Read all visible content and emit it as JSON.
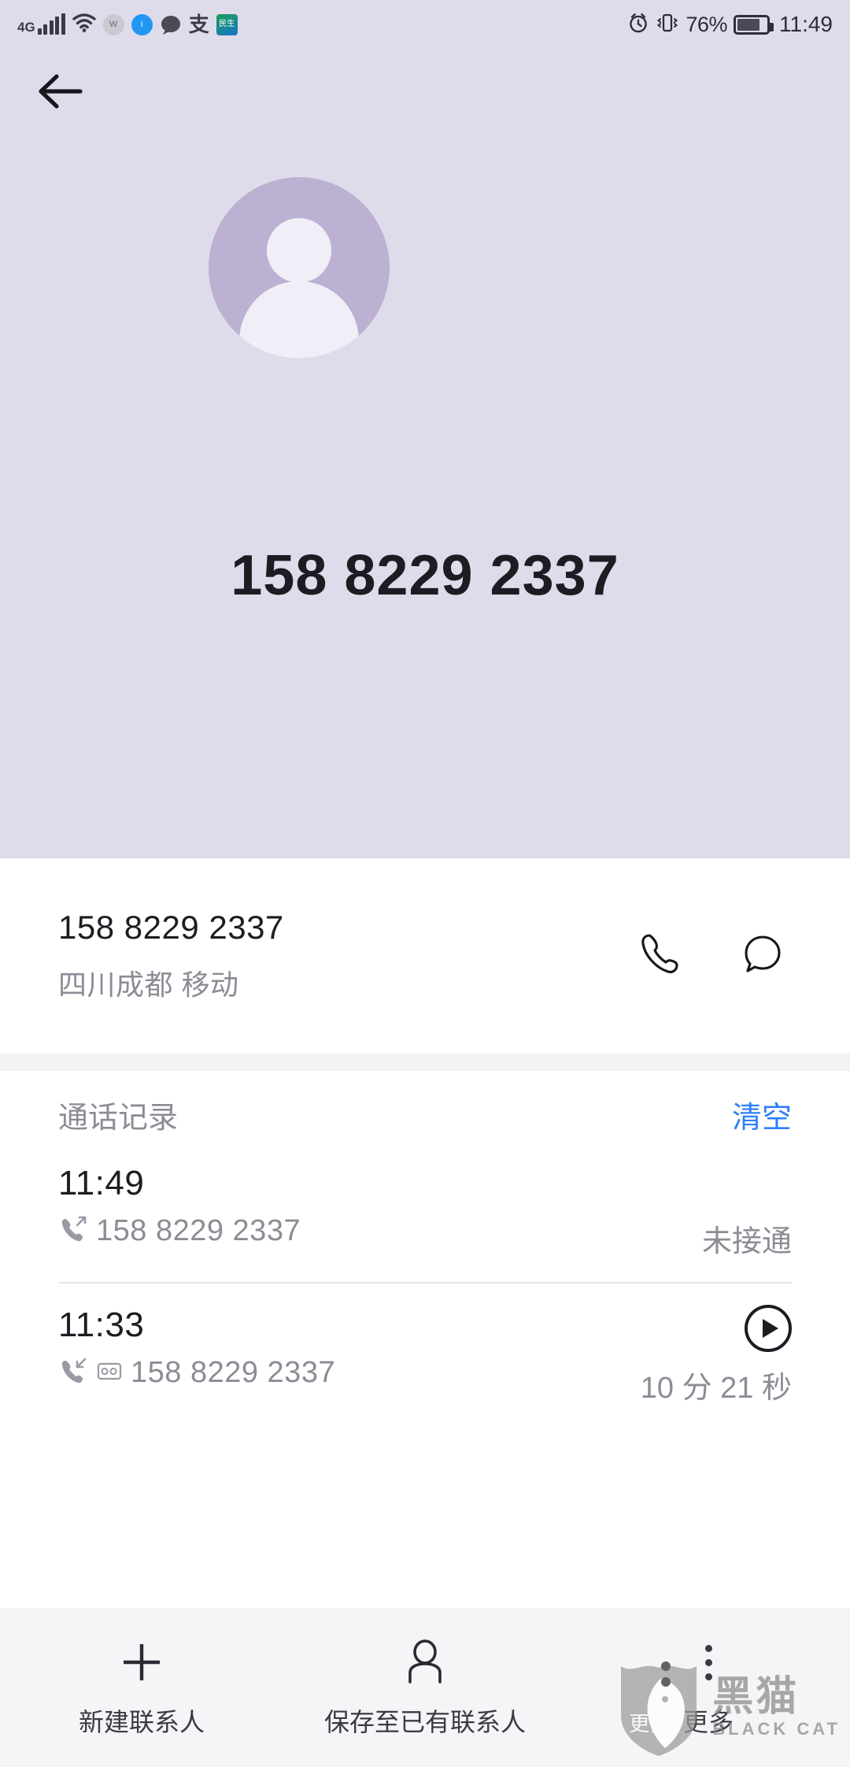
{
  "statusbar": {
    "network": "4G",
    "signal_icon": "signal-bars-icon",
    "wifi_icon": "wifi-icon",
    "app_icons": [
      "app-icon-grey",
      "app-icon-blue",
      "app-icon-bubble",
      "app-icon-alipay",
      "app-icon-minsheng"
    ],
    "alipay_glyph": "支",
    "minsheng_glyph": "民生",
    "alarm_icon": "alarm-clock-icon",
    "vibrate_icon": "vibrate-icon",
    "battery_percent": "76%",
    "battery_icon": "battery-icon",
    "time": "11:49"
  },
  "header": {
    "back_icon": "back-arrow-icon",
    "avatar_icon": "default-avatar-icon",
    "phone_number": "158 8229 2337",
    "background_color": "#dedcea",
    "avatar_color": "#bdb1d3"
  },
  "info_card": {
    "number": "158 8229 2337",
    "carrier": "四川成都 移动",
    "call_icon": "phone-call-icon",
    "message_icon": "message-bubble-icon"
  },
  "call_log": {
    "title": "通话记录",
    "clear_label": "清空",
    "clear_color": "#2d7ff9",
    "records": [
      {
        "time": "11:49",
        "direction_icon": "outgoing-call-icon",
        "has_recording": false,
        "number": "158 8229 2337",
        "status": "未接通",
        "duration": "",
        "playable": false
      },
      {
        "time": "11:33",
        "direction_icon": "incoming-call-icon",
        "has_recording": true,
        "recording_icon": "voice-recording-icon",
        "number": "158 8229 2337",
        "status": "",
        "duration": "10 分 21 秒",
        "playable": true,
        "play_icon": "play-circle-icon"
      }
    ]
  },
  "bottom_bar": {
    "items": [
      {
        "icon": "plus-icon",
        "label": "新建联系人"
      },
      {
        "icon": "person-icon",
        "label": "保存至已有联系人"
      },
      {
        "icon": "more-dots-icon",
        "label": "更多"
      }
    ]
  },
  "watermark": {
    "cn": "黑猫",
    "en": "BLACK CAT",
    "shield_icon": "black-cat-shield-icon"
  }
}
